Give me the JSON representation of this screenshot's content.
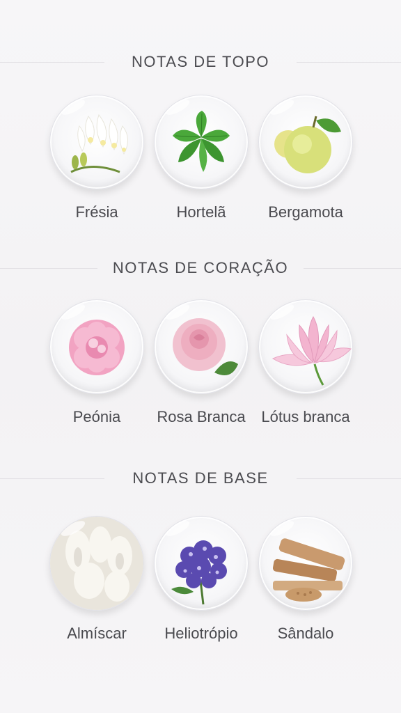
{
  "sections": [
    {
      "title": "NOTAS DE TOPO",
      "notes": [
        {
          "label": "Frésia",
          "icon": "freesia-icon"
        },
        {
          "label": "Hortelã",
          "icon": "mint-icon"
        },
        {
          "label": "Bergamota",
          "icon": "bergamot-icon"
        }
      ]
    },
    {
      "title": "NOTAS DE CORAÇÃO",
      "notes": [
        {
          "label": "Peónia",
          "icon": "peony-icon"
        },
        {
          "label": "Rosa Branca",
          "icon": "rose-icon"
        },
        {
          "label": "Lótus branca",
          "icon": "lotus-icon"
        }
      ]
    },
    {
      "title": "NOTAS DE BASE",
      "notes": [
        {
          "label": "Almíscar",
          "icon": "musk-icon"
        },
        {
          "label": "Heliotrópio",
          "icon": "heliotrope-icon"
        },
        {
          "label": "Sândalo",
          "icon": "sandalwood-icon"
        }
      ]
    }
  ]
}
